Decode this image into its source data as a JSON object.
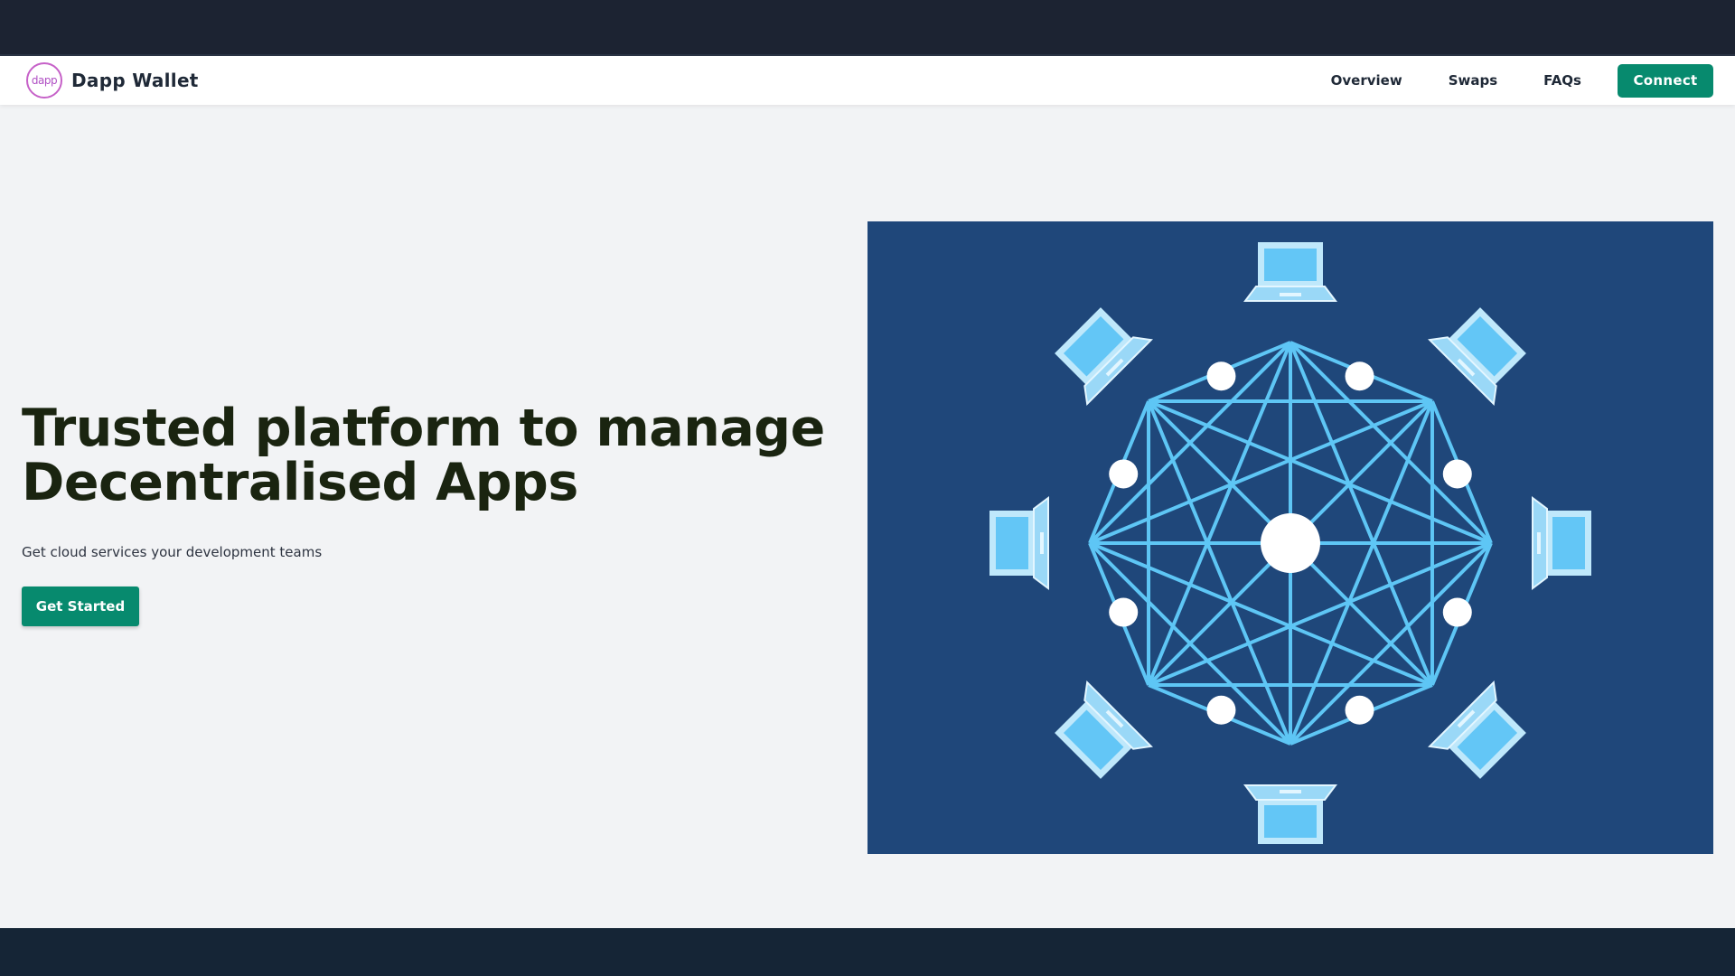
{
  "brand": {
    "logo_text": "dapp",
    "name": "Dapp Wallet"
  },
  "nav": {
    "links": [
      "Overview",
      "Swaps",
      "FAQs"
    ],
    "connect_label": "Connect"
  },
  "hero": {
    "title_line1": "Trusted platform to manage",
    "title_line2": "Decentralised Apps",
    "subtitle": "Get cloud services your development teams",
    "cta_label": "Get Started"
  },
  "illustration": {
    "subject": "network-of-laptops-icon",
    "background_color": "#1f477a",
    "line_color": "#5ec6f5",
    "node_color": "#ffffff"
  },
  "colors": {
    "accent": "#078a6e",
    "top_bar": "#1c2332",
    "footer": "#152536",
    "page_bg": "#f2f3f5"
  }
}
